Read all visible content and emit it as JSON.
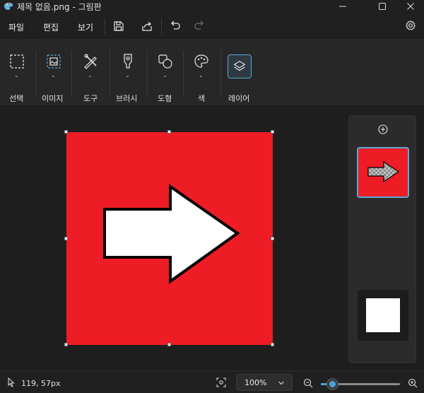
{
  "window": {
    "title": "제목 없음.png - 그림판"
  },
  "menu": {
    "items": [
      "파일",
      "편집",
      "보기"
    ],
    "icons": [
      "save-icon",
      "share-icon",
      "undo-icon",
      "redo-icon",
      "settings-icon"
    ]
  },
  "ribbon": {
    "groups": [
      {
        "label": "선택",
        "icon": "selection-icon"
      },
      {
        "label": "이미지",
        "icon": "image-icon"
      },
      {
        "label": "도구",
        "icon": "tools-icon"
      },
      {
        "label": "브러시",
        "icon": "brush-icon"
      },
      {
        "label": "도형",
        "icon": "shapes-icon"
      },
      {
        "label": "색",
        "icon": "palette-icon"
      },
      {
        "label": "레이어",
        "icon": "layers-icon"
      }
    ]
  },
  "canvas": {
    "image_color": "#ee1c25",
    "arrow_color": "#ffffff"
  },
  "layers": {
    "add_icon": "add-layer-icon"
  },
  "status": {
    "coords": "119, 57px",
    "zoom": "100%",
    "zoom_level": 0.15
  },
  "colors": {
    "accent": "#4aa3df",
    "background": "#202020",
    "ribbon": "#272727"
  }
}
